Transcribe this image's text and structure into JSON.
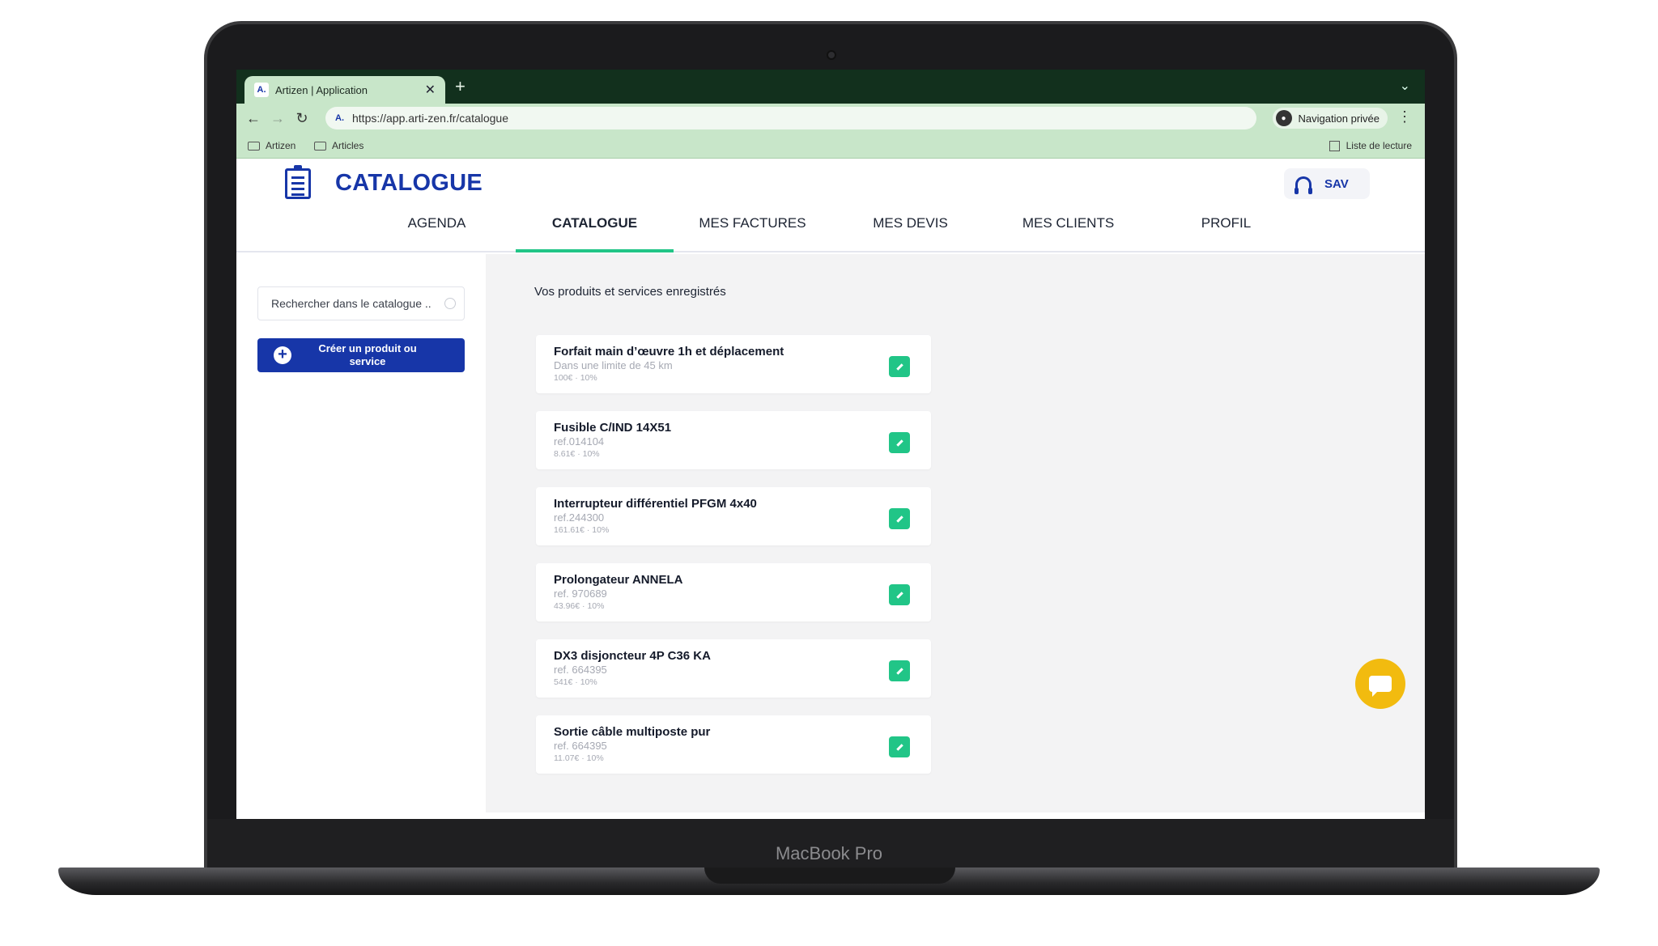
{
  "device": {
    "label": "MacBook Pro"
  },
  "browser": {
    "tab_title": "Artizen | Application",
    "tab_favicon": "A.",
    "tab_close": "✕",
    "new_tab": "+",
    "tabs_dropdown": "⌄",
    "url": "https://app.arti-zen.fr/catalogue",
    "private_label": "Navigation privée",
    "menu": "⋮",
    "bookmarks": [
      "Artizen",
      "Articles"
    ],
    "reading_list": "Liste de lecture"
  },
  "app": {
    "page_title": "CATALOGUE",
    "sav_label": "SAV",
    "nav": [
      {
        "label": "AGENDA",
        "active": false
      },
      {
        "label": "CATALOGUE",
        "active": true
      },
      {
        "label": "MES FACTURES",
        "active": false
      },
      {
        "label": "MES DEVIS",
        "active": false
      },
      {
        "label": "MES CLIENTS",
        "active": false
      },
      {
        "label": "PROFIL",
        "active": false
      }
    ],
    "search_placeholder": "Rechercher dans le catalogue ..",
    "create_button": "Créer un produit ou service",
    "section_title": "Vos produits et services enregistrés",
    "items": [
      {
        "title": "Forfait main d’œuvre 1h et déplacement",
        "subtitle": "Dans une limite de 45 km",
        "price": "100€ · 10%"
      },
      {
        "title": "Fusible C/IND 14X51",
        "subtitle": "ref.014104",
        "price": "8.61€ · 10%"
      },
      {
        "title": "Interrupteur différentiel PFGM 4x40",
        "subtitle": "ref.244300",
        "price": "161.61€ · 10%"
      },
      {
        "title": "Prolongateur ANNELA",
        "subtitle": "ref. 970689",
        "price": "43.96€ · 10%"
      },
      {
        "title": "DX3 disjoncteur 4P C36 KA",
        "subtitle": "ref. 664395",
        "price": "541€ · 10%"
      },
      {
        "title": "Sortie câble multiposte pur",
        "subtitle": "ref. 664395",
        "price": "11.07€ · 10%"
      }
    ]
  },
  "icons": {
    "back": "back-arrow-icon",
    "forward": "forward-arrow-icon",
    "reload": "reload-icon",
    "edit": "pencil-icon",
    "chat": "chat-bubble-icon",
    "support": "headset-icon"
  },
  "colors": {
    "brand_blue": "#1736a8",
    "accent_green": "#21c587",
    "browser_green": "#c8e6c9",
    "chat_yellow": "#f2bb0f"
  }
}
